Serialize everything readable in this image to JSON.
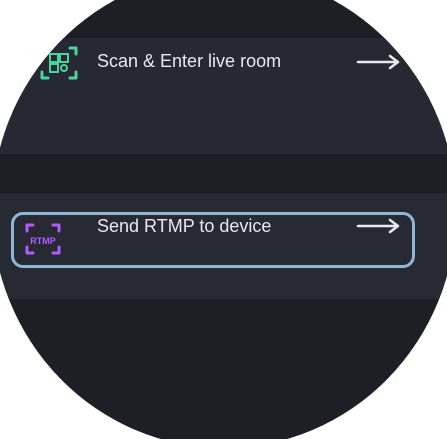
{
  "menu": {
    "items": [
      {
        "label": "Scan & Enter live room",
        "icon": "qr-scan-icon",
        "arrow": "arrow-right-icon"
      },
      {
        "label": "Send RTMP to device",
        "icon": "rtmp-icon",
        "icon_text": "RTMP",
        "arrow": "arrow-right-icon",
        "highlighted": true
      }
    ]
  },
  "colors": {
    "background": "#1d1f26",
    "row": "#262932",
    "accent_green": "#49d39e",
    "accent_purple": "#b05cff",
    "highlight_border": "#8fb8d8"
  }
}
